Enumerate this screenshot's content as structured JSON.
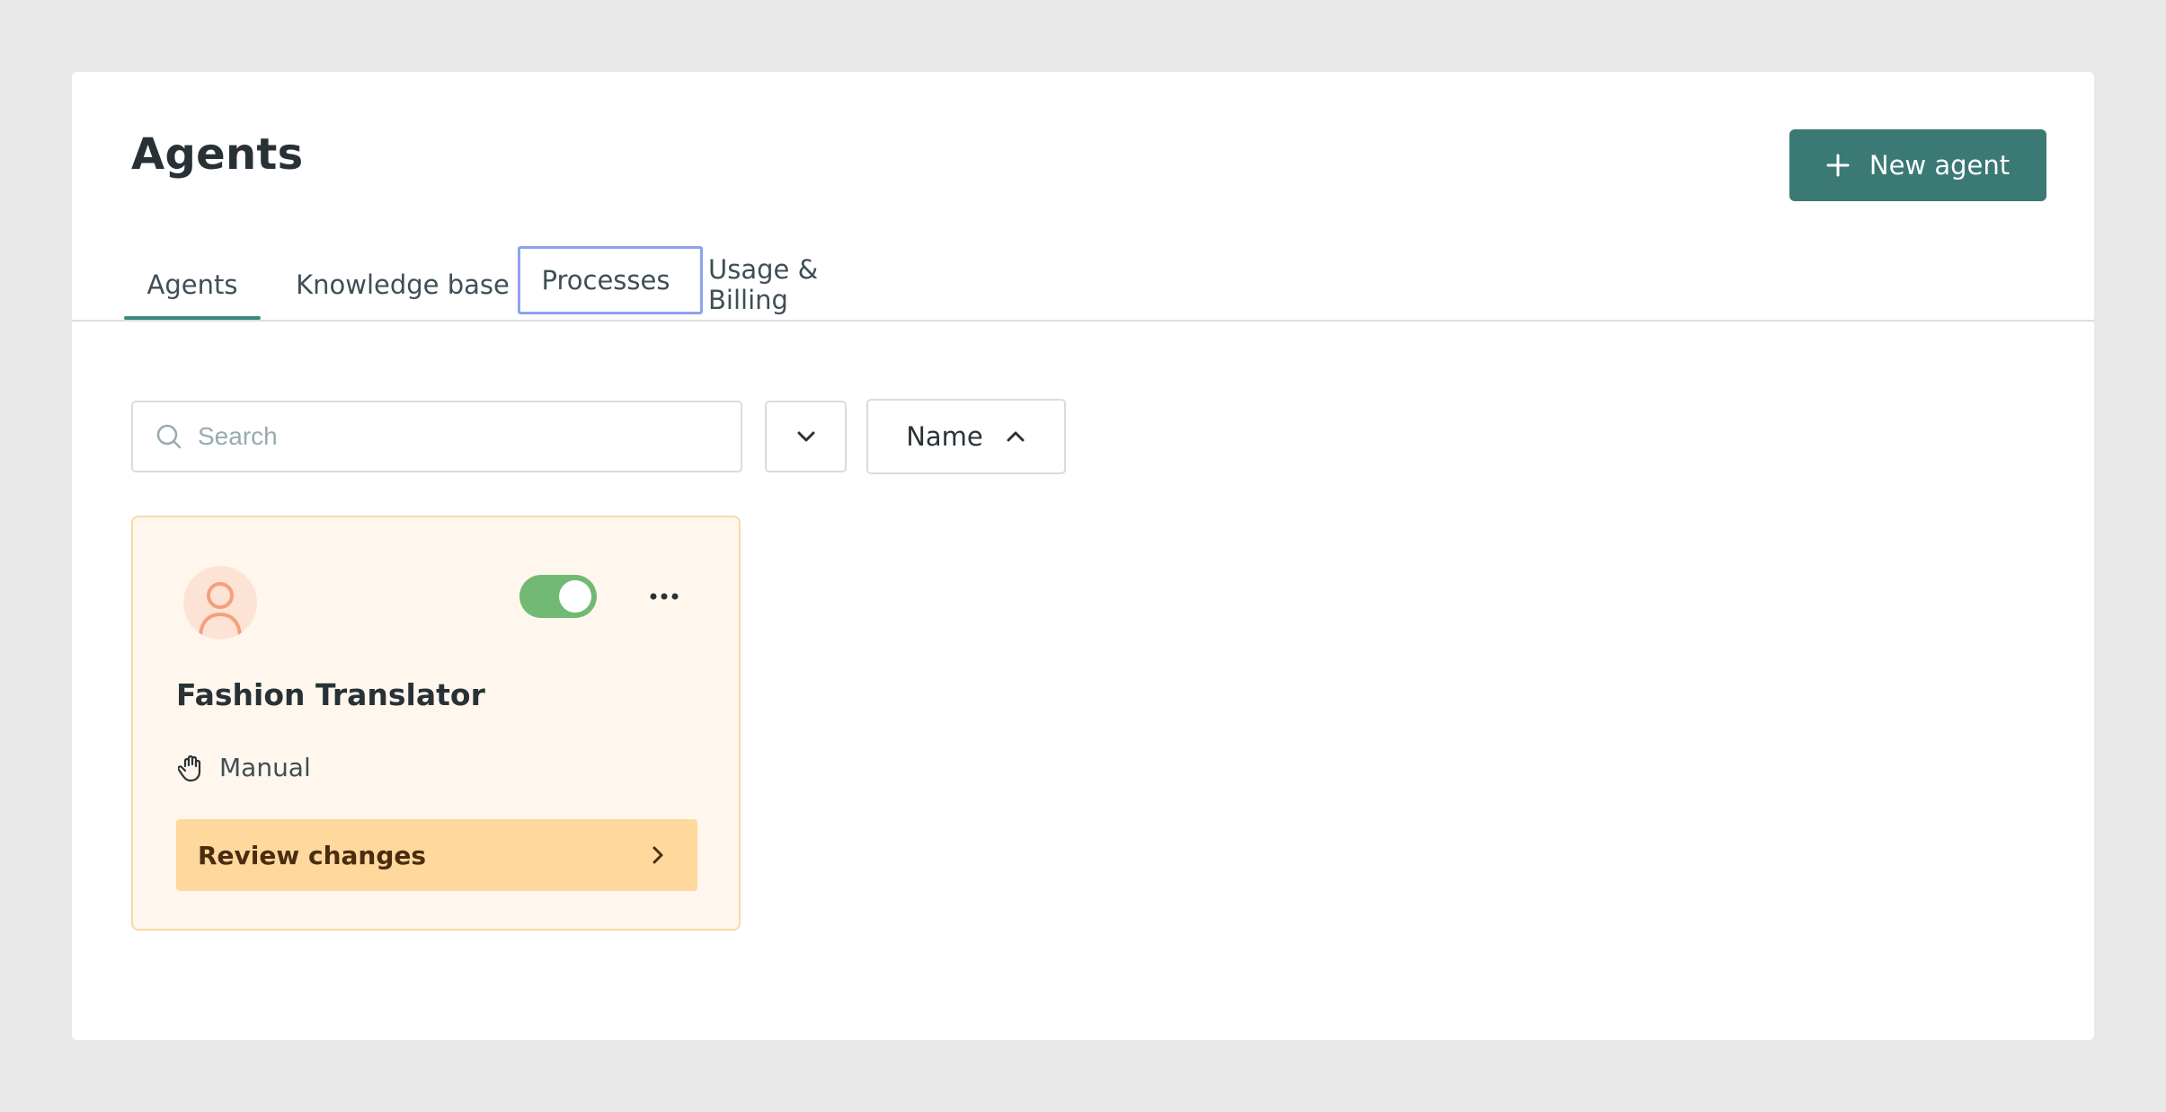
{
  "header": {
    "title": "Agents",
    "new_agent_label": "New agent"
  },
  "tabs": [
    {
      "label": "Agents",
      "active": true
    },
    {
      "label": "Knowledge base",
      "active": false
    },
    {
      "label": "Processes",
      "active": false,
      "focused": true
    },
    {
      "label": "Usage & Billing",
      "active": false
    }
  ],
  "toolbar": {
    "search_placeholder": "Search",
    "search_value": "",
    "sort_label": "Name"
  },
  "agents": [
    {
      "name": "Fashion Translator",
      "enabled": true,
      "mode": "Manual",
      "action_label": "Review changes"
    }
  ],
  "colors": {
    "primary": "#3b7a74",
    "tab_underline": "#3b8b7f",
    "card_bg": "#fff7ee",
    "card_border": "#f7d9a6",
    "toggle_on": "#72b973",
    "review_bg": "#ffd89e",
    "focus_ring": "#8ea2ee"
  }
}
